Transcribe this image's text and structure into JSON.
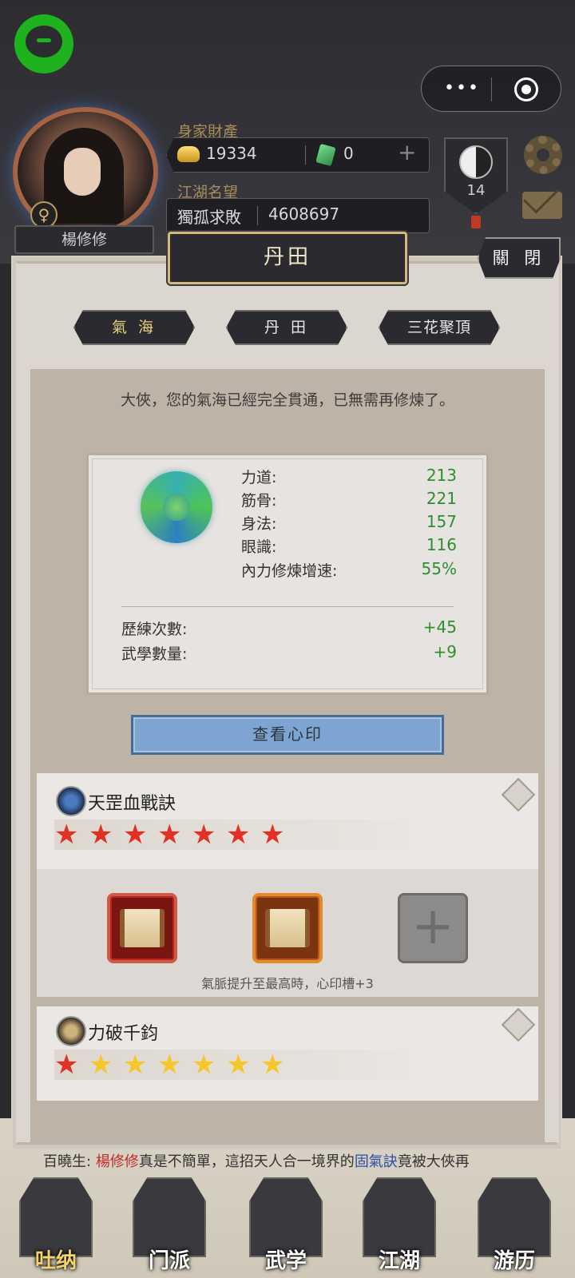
{
  "header": {
    "player_name": "楊修修",
    "gender_symbol": "♀",
    "wealth_label": "身家財產",
    "gold": "19334",
    "jade": "0",
    "add_symbol": "+",
    "fame_label": "江湖名望",
    "fame_title": "獨孤求敗",
    "fame_value": "4608697",
    "rank_number": "14"
  },
  "capsule": {
    "more_symbol": "•••"
  },
  "panel": {
    "title": "丹田",
    "close_label": "關 閉",
    "tabs": [
      {
        "label": "氣 海",
        "active": true
      },
      {
        "label": "丹 田",
        "active": false
      },
      {
        "label": "三花聚頂",
        "active": false
      }
    ],
    "message": "大俠，您的氣海已經完全貫通，已無需再修煉了。"
  },
  "stats": [
    {
      "label": "力道:",
      "value": "213"
    },
    {
      "label": "筋骨:",
      "value": "221"
    },
    {
      "label": "身法:",
      "value": "157"
    },
    {
      "label": "眼識:",
      "value": "116"
    },
    {
      "label": "內力修煉增速:",
      "value": "55%"
    }
  ],
  "bonuses": [
    {
      "label": "歷練次數:",
      "value": "+45"
    },
    {
      "label": "武學數量:",
      "value": "+9"
    }
  ],
  "seal_button_label": "查看心印",
  "skills": [
    {
      "name": "天罡血戰訣",
      "stars": 7,
      "star_color": "#e23024"
    },
    {
      "name": "力破千鈞",
      "stars": 7,
      "star_color": "#f6c62a",
      "first_star_color": "#e23024"
    }
  ],
  "slots": {
    "hint": "氣脈提升至最高時，心印槽+3",
    "empty_symbol": "+"
  },
  "ticker": {
    "speaker": "百曉生:",
    "player": "楊修修",
    "text_1": "真是不簡單，這招天人合一境界的",
    "skill": "固氣訣",
    "text_2": "竟被大俠再"
  },
  "bottom_nav": [
    {
      "label": "吐纳",
      "active": true
    },
    {
      "label": "门派",
      "active": false
    },
    {
      "label": "武学",
      "active": false
    },
    {
      "label": "江湖",
      "active": false
    },
    {
      "label": "游历",
      "active": false
    }
  ]
}
